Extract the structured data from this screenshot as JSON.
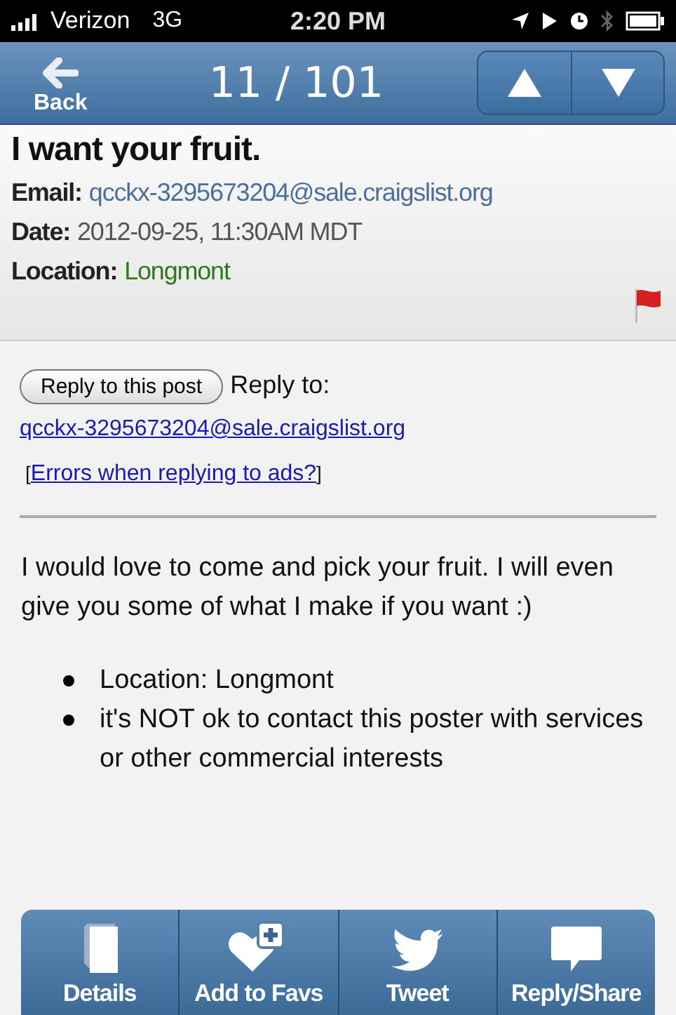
{
  "status_bar": {
    "carrier": "Verizon",
    "network": "3G",
    "time": "2:20 PM"
  },
  "nav": {
    "back": "Back",
    "counter": "11 / 101"
  },
  "post": {
    "title": "I want your fruit.",
    "fields": [
      {
        "kind": "link",
        "label": "Email:",
        "value": "qcckx-3295673204@sale.craigslist.org"
      },
      {
        "kind": "plain",
        "label": "Date:",
        "value": "2012-09-25, 11:30AM MDT"
      },
      {
        "kind": "place",
        "label": "Location:",
        "value": "Longmont"
      }
    ],
    "flagged": true
  },
  "reply": {
    "button": "Reply to this post",
    "label": "Reply to:",
    "email": "qcckx-3295673204@sale.craigslist.org",
    "open": "[",
    "errors_link": "Errors when replying to ads?",
    "close": "]"
  },
  "body": {
    "text": "I would love to come and pick your fruit. I will even give you some of what I make if you want :)",
    "bullets": [
      "Location: Longmont",
      "it's NOT ok to contact this poster with services or other commercial interests"
    ]
  },
  "toolbar": [
    {
      "kind": "book",
      "label": "Details"
    },
    {
      "kind": "fav",
      "label": "Add to Favs"
    },
    {
      "kind": "bird",
      "label": "Tweet"
    },
    {
      "kind": "bubble",
      "label": "Reply/Share"
    }
  ]
}
